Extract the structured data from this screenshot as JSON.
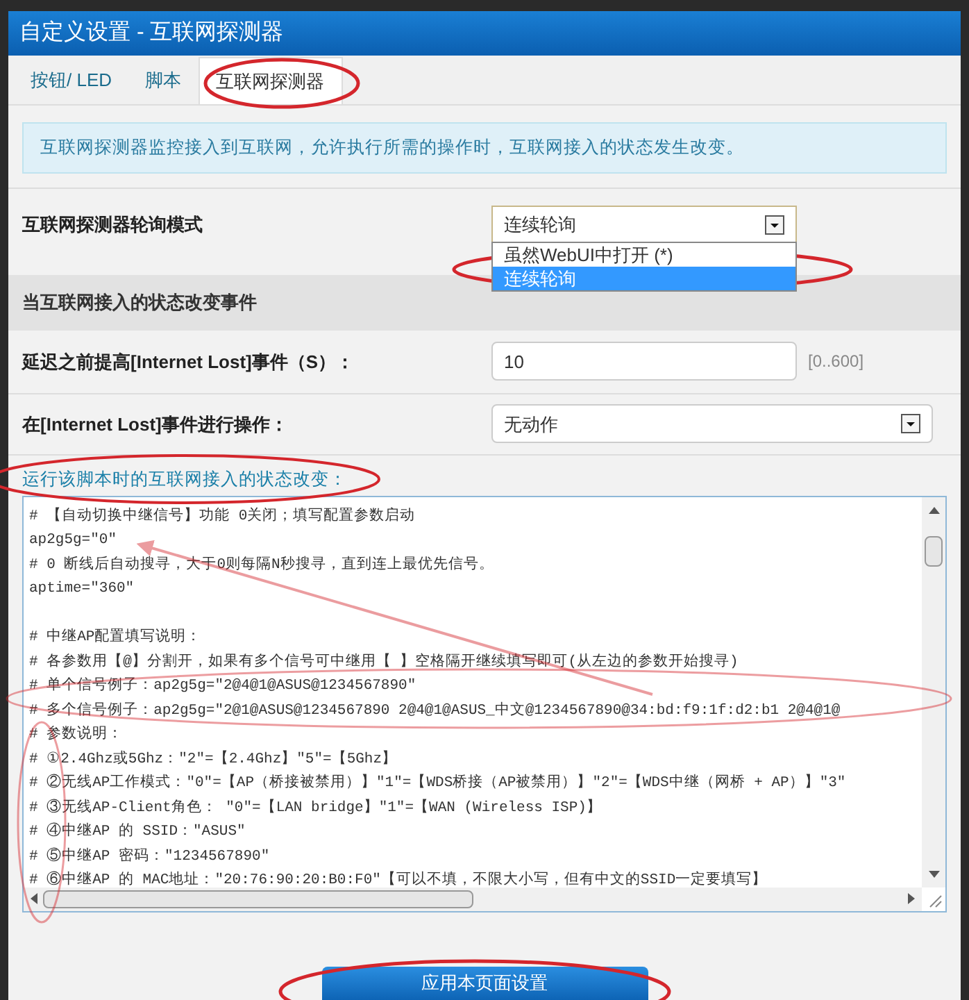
{
  "window": {
    "title": "自定义设置 - 互联网探测器"
  },
  "tabs": [
    {
      "label": "按钮/ LED",
      "selected": false
    },
    {
      "label": "脚本",
      "selected": false
    },
    {
      "label": "互联网探测器",
      "selected": true
    }
  ],
  "info": "互联网探测器监控接入到互联网，允许执行所需的操作时，互联网接入的状态发生改变。",
  "polling_mode": {
    "label": "互联网探测器轮询模式",
    "value": "连续轮询",
    "options": [
      {
        "label": "虽然WebUI中打开 (*)",
        "selected": false
      },
      {
        "label": "连续轮询",
        "selected": true
      }
    ]
  },
  "section": {
    "title": "当互联网接入的状态改变事件"
  },
  "delay": {
    "label": "延迟之前提高[Internet Lost]事件（S）：",
    "value": "10",
    "range": "[0..600]"
  },
  "action": {
    "label": "在[Internet Lost]事件进行操作：",
    "value": "无动作"
  },
  "script": {
    "label": "运行该脚本时的互联网接入的状态改变：",
    "lines": [
      {
        "kind": "code",
        "text": "# 【自动切换中继信号】功能 0关闭；填写配置参数启动"
      },
      {
        "kind": "code",
        "text": "ap2g5g=\"0\""
      },
      {
        "kind": "code",
        "text": "# 0 断线后自动搜寻，大于0则每隔N秒搜寻，直到连上最优先信号。"
      },
      {
        "kind": "code",
        "text": "aptime=\"360\""
      },
      {
        "kind": "blank"
      },
      {
        "kind": "code",
        "text": "# 中继AP配置填写说明："
      },
      {
        "kind": "code",
        "text": "# 各参数用【@】分割开，如果有多个信号可中继用【 】空格隔开继续填写即可(从左边的参数开始搜寻)"
      },
      {
        "kind": "code",
        "text": "# 单个信号例子：ap2g5g=\"2@4@1@ASUS@1234567890\""
      },
      {
        "kind": "code",
        "text": "# 多个信号例子：ap2g5g=\"2@1@ASUS@1234567890 2@4@1@ASUS_中文@1234567890@34:bd:f9:1f:d2:b1 2@4@1@"
      },
      {
        "kind": "code",
        "text": "# 参数说明："
      },
      {
        "kind": "code",
        "text": "# ①2.4Ghz或5Ghz：\"2\"=【2.4Ghz】\"5\"=【5Ghz】"
      },
      {
        "kind": "code",
        "text": "# ②无线AP工作模式：\"0\"=【AP（桥接被禁用）】\"1\"=【WDS桥接（AP被禁用）】\"2\"=【WDS中继（网桥 + AP）】\"3\""
      },
      {
        "kind": "code",
        "text": "# ③无线AP-Client角色： \"0\"=【LAN bridge】\"1\"=【WAN (Wireless ISP)】"
      },
      {
        "kind": "code",
        "text": "# ④中继AP 的 SSID：\"ASUS\""
      },
      {
        "kind": "code",
        "text": "# ⑤中继AP 密码：\"1234567890\""
      },
      {
        "kind": "code",
        "text": "# ⑥中继AP 的 MAC地址：\"20:76:90:20:B0:F0\"【可以不填，不限大小写，但有中文的SSID一定要填写】"
      }
    ]
  },
  "apply_button": "应用本页面设置"
}
